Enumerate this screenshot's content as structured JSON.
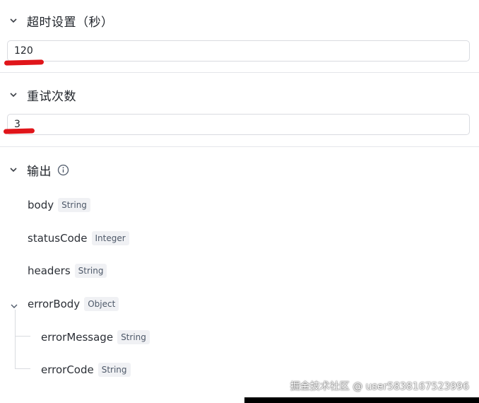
{
  "timeout": {
    "title": "超时设置（秒）",
    "value": "120"
  },
  "retry": {
    "title": "重试次数",
    "value": "3"
  },
  "output": {
    "title": "输出",
    "fields": [
      {
        "name": "body",
        "type": "String"
      },
      {
        "name": "statusCode",
        "type": "Integer"
      },
      {
        "name": "headers",
        "type": "String"
      },
      {
        "name": "errorBody",
        "type": "Object"
      },
      {
        "name": "errorMessage",
        "type": "String"
      },
      {
        "name": "errorCode",
        "type": "String"
      }
    ]
  },
  "watermark": {
    "text": "掘金技术社区 @ user5838167523996"
  },
  "colors": {
    "annotation_red": "#e0151a",
    "border": "#d9dbe0",
    "tag_bg": "#f0f1f4"
  }
}
